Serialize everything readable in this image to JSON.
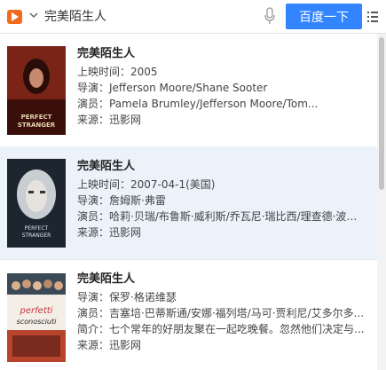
{
  "search": {
    "query": "完美陌生人",
    "button_label": "百度一下"
  },
  "colors": {
    "accent": "#3385ff",
    "logo": "#f26b1d",
    "selected_row": "#ebf2fa"
  },
  "icons": [
    "app-logo-icon",
    "chevron-down-icon",
    "microphone-icon",
    "menu-icon"
  ],
  "results": [
    {
      "title": "完美陌生人",
      "poster_text": "PERFECT STRANGER",
      "lines": [
        "上映时间：2005",
        "导演：Jefferson Moore/Shane Sooter",
        "演员：Pamela Brumley/Jefferson Moore/Tom...",
        "来源：迅影网"
      ]
    },
    {
      "title": "完美陌生人",
      "poster_text": "PERFECT STRANGER",
      "lines": [
        "上映时间：2007-04-1(美国)",
        "导演：詹姆斯·弗雷",
        "演员：哈莉·贝瑞/布鲁斯·威利斯/乔瓦尼·瑞比西/理查德·波特...",
        "来源：迅影网"
      ]
    },
    {
      "title": "完美陌生人",
      "poster_text": "perfetti sconosciuti",
      "lines": [
        "导演：保罗·格诺维瑟",
        "演员：吉塞培·巴蒂斯通/安娜·福列塔/马可·贾利尼/艾多尔多...",
        "简介：七个常年的好朋友聚在一起吃晚餐。忽然他们决定与...",
        "来源：迅影网"
      ]
    }
  ]
}
